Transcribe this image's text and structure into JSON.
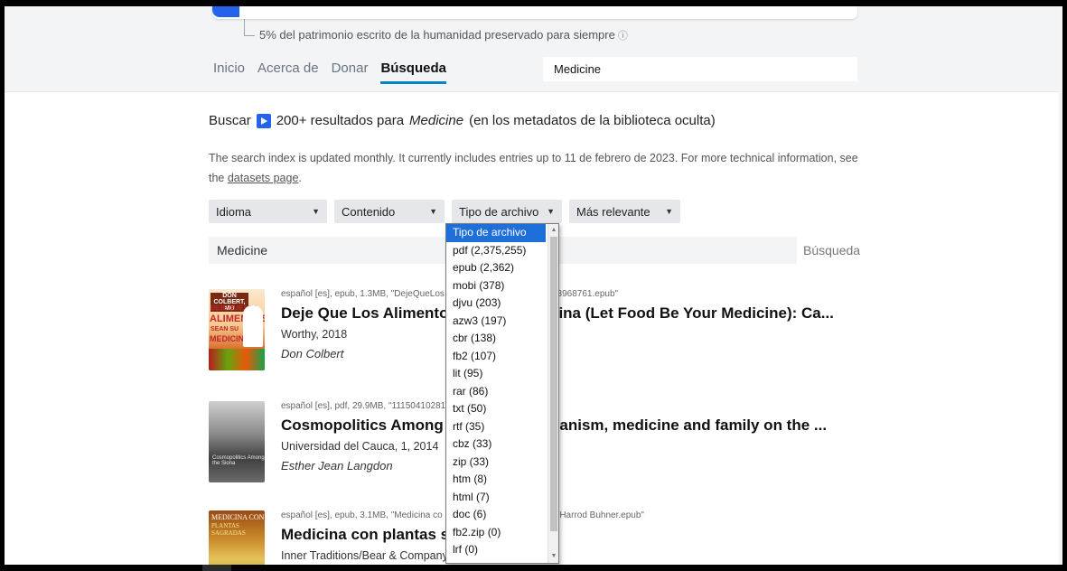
{
  "header": {
    "tagline": "5% del patrimonio escrito de la humanidad preservado para siempre",
    "tagline_icon": "info-icon",
    "nav": {
      "inicio": "Inicio",
      "acerca": "Acerca de",
      "donar": "Donar",
      "busqueda": "Búsqueda"
    },
    "search_value": "Medicine"
  },
  "summary": {
    "prefix": "Buscar",
    "count": "200+ resultados para",
    "term": "Medicine",
    "suffix": "(en los metadatos de la biblioteca oculta)"
  },
  "index_note": {
    "text": "The search index is updated monthly. It currently includes entries up to 11 de febrero de 2023. For more technical information, see the ",
    "link": "datasets page",
    "end": "."
  },
  "filters": {
    "idioma": "Idioma",
    "contenido": "Contenido",
    "tipo": "Tipo de archivo",
    "orden": "Más relevante"
  },
  "query": {
    "value": "Medicine",
    "submit": "Búsqueda"
  },
  "results": [
    {
      "meta": "español [es], epub, 1.3MB, \"DejeQueLos",
      "meta_end": "_3968761.epub\"",
      "title": "Deje Que Los Alimento",
      "title_end": "cina (Let Food Be Your Medicine): Ca...",
      "publisher": "Worthy, 2018",
      "author": "Don Colbert",
      "cover": {
        "author": "DON COLBERT, MD",
        "line1": "DEJE QUE LOS",
        "line2": "ALIMENTOS",
        "line3": "SEAN SU",
        "line4": "MEDICINA"
      }
    },
    {
      "meta": "español [es], pdf, 29.9MB, \"11150410281",
      "title": "Cosmopolitics Among",
      "title_end": "nanism, medicine and family on the ...",
      "publisher": "Universidad del Cauca, 1, 2014",
      "author": "Esther Jean Langdon",
      "cover": {
        "text": "Cosmopolitics Among the Siona"
      }
    },
    {
      "meta": "español [es], epub, 3.1MB, \"Medicina co",
      "meta_end": "n Harrod Buhner.epub\"",
      "title": "Medicina con plantas s",
      "publisher": "Inner Traditions/Bear & Company",
      "cover": {
        "line1": "MEDICINA CON",
        "line2": "PLANTAS SAGRADAS"
      }
    }
  ],
  "dropdown": {
    "options": [
      "Tipo de archivo",
      "pdf (2,375,255)",
      "epub (2,362)",
      "mobi (378)",
      "djvu (203)",
      "azw3 (197)",
      "cbr (138)",
      "fb2 (107)",
      "lit (95)",
      "rar (86)",
      "txt (50)",
      "rtf (35)",
      "cbz (33)",
      "zip (33)",
      "htm (8)",
      "html (7)",
      "doc (6)",
      "fb2.zip (0)",
      "lrf (0)"
    ],
    "selected": "Tipo de archivo"
  }
}
